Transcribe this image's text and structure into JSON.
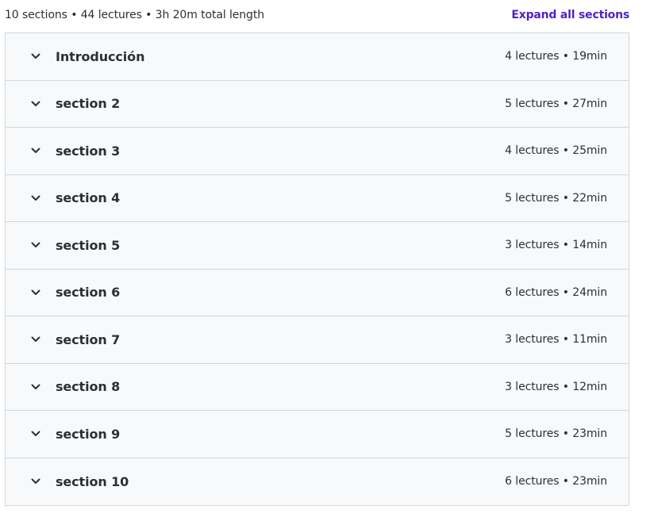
{
  "summary": {
    "text": "10 sections • 44 lectures • 3h 20m total length",
    "expand_label": "Expand all sections"
  },
  "colors": {
    "accent": "#5022c3",
    "row_bg": "#f7f9fa",
    "border": "#d1d7dc",
    "text": "#2d2f31"
  },
  "sections": [
    {
      "title": "Introducción",
      "meta": "4 lectures • 19min",
      "icon": "chevron-down-icon"
    },
    {
      "title": "section 2",
      "meta": "5 lectures • 27min",
      "icon": "chevron-down-icon"
    },
    {
      "title": "section 3",
      "meta": "4 lectures • 25min",
      "icon": "chevron-down-icon"
    },
    {
      "title": "section 4",
      "meta": "5 lectures • 22min",
      "icon": "chevron-down-icon"
    },
    {
      "title": "section 5",
      "meta": "3 lectures • 14min",
      "icon": "chevron-down-icon"
    },
    {
      "title": "section 6",
      "meta": "6 lectures • 24min",
      "icon": "chevron-down-icon"
    },
    {
      "title": "section 7",
      "meta": "3 lectures • 11min",
      "icon": "chevron-down-icon"
    },
    {
      "title": "section 8",
      "meta": "3 lectures • 12min",
      "icon": "chevron-down-icon"
    },
    {
      "title": "section 9",
      "meta": "5 lectures • 23min",
      "icon": "chevron-down-icon"
    },
    {
      "title": "section 10",
      "meta": "6 lectures • 23min",
      "icon": "chevron-down-icon"
    }
  ]
}
